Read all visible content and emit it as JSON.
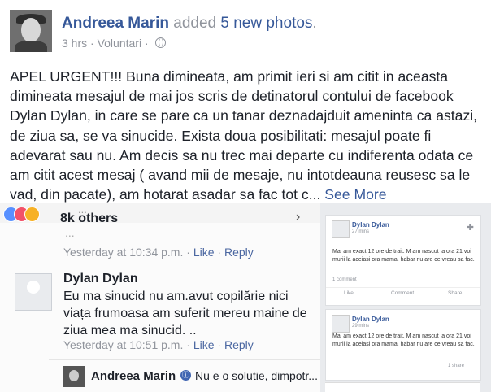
{
  "post": {
    "author": "Andreea Marin",
    "action": "added",
    "photos_link": "5 new photos",
    "period": ".",
    "time": "3 hrs",
    "location": "Voluntari",
    "text": "APEL URGENT!!! Buna dimineata, am primit ieri si am citit in aceasta dimineata mesajul de mai jos scris de detinatorul contului de facebook Dylan Dylan, in care se pare ca un tanar deznadajduit ameninta ca astazi, de ziua sa, se va sinucide. Exista doua posibilitati: mesajul poate fi adevarat sau nu. Am decis sa nu trec mai departe cu indiferenta odata ce am citit acest mesaj ( avand mii de mesaje, nu intotdeauna reusesc sa le vad, din pacate), am hotarat asadar sa fac tot c...",
    "see_more": "See More"
  },
  "icons": [
    "globe-icon",
    "like-reaction-icon",
    "love-reaction-icon",
    "haha-reaction-icon",
    "chevron-right-icon",
    "plus-icon"
  ],
  "colors": {
    "link": "#365899",
    "muted": "#90949c",
    "reaction_blue": "#4267b2"
  },
  "photo_left": {
    "cut_top": "...",
    "reactions_count": "8k others",
    "cut_line": "...",
    "comment1_meta": {
      "time": "Yesterday at 10:34 p.m.",
      "sep": "·",
      "like": "Like",
      "reply": "Reply"
    },
    "comment": {
      "name": "Dylan Dylan",
      "text": "Eu ma sinucid nu am.avut copilărie nici viața frumoasa am suferit mereu maine de ziua mea ma sinucid. ..",
      "time": "Yesterday at 10:51 p.m.",
      "sep": "·",
      "like": "Like",
      "reply": "Reply"
    },
    "reply": {
      "name": "Andreea Marin",
      "icon": "ⓘ",
      "text": "Nu e o solutie, dimpotr..."
    }
  },
  "photo_right": {
    "card1": {
      "name": "Dylan Dylan",
      "time": "27 mins",
      "text": "Mai am exact 12 ore de trait. M am nascut la ora 21 voi murii la aceiasi ora mama. habar nu are ce vreau sa fac.",
      "count": "1 comment",
      "like": "Like",
      "comment": "Comment",
      "share": "Share"
    },
    "card2": {
      "name": "Dylan Dylan",
      "time": "29 mins",
      "text": "Mai am exact 12 ore de trait. M am nascut la ora 21 voi murii la aceiasi ora mama. habar nu are ce vreau sa fac.",
      "count": "1 share"
    }
  }
}
